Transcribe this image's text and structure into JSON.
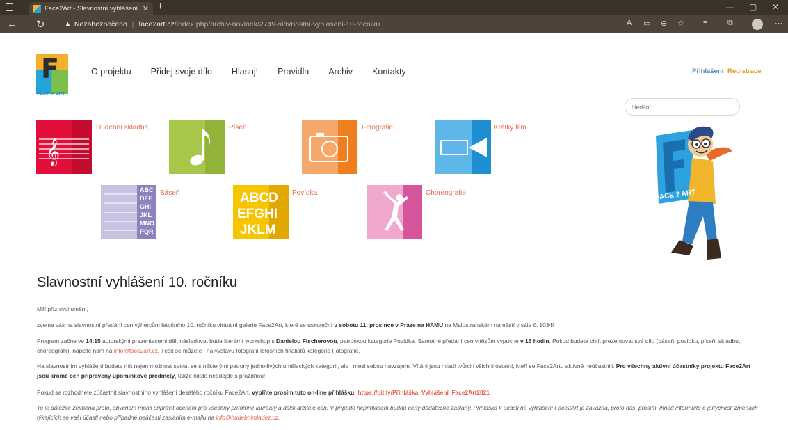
{
  "browser": {
    "tab_title": "Face2Art - Slavnostní vyhlášení 1",
    "security_label": "Nezabezpečeno",
    "url_domain": "face2art.cz",
    "url_path": "/index.php/archiv-novinek/2749-slavnostni-vyhlaseni-10-rocniku"
  },
  "logo": {
    "text": "FACE 2 ART"
  },
  "nav": [
    "O projektu",
    "Přidej svoje dílo",
    "Hlasuj!",
    "Pravidla",
    "Archiv",
    "Kontakty"
  ],
  "auth": {
    "login": "Přihlášení",
    "register": "Registrace"
  },
  "search": {
    "placeholder": "hledání"
  },
  "categories": [
    {
      "label": "Hudební skladba",
      "color": "#e20f3a"
    },
    {
      "label": "Píseň",
      "color": "#a7c74a"
    },
    {
      "label": "Fotografie",
      "color": "#f0812b"
    },
    {
      "label": "Krátký film",
      "color": "#1e8fd3"
    },
    {
      "label": "Báseň",
      "color": "#9c93c6"
    },
    {
      "label": "Povídka",
      "color": "#f5c200"
    },
    {
      "label": "Choreografie",
      "color": "#d6569d"
    }
  ],
  "tiles": {
    "basen": [
      "ABC",
      "DEF",
      "GHI",
      "JKL",
      "MNO",
      "PQR"
    ],
    "povidka": [
      "ABCD",
      "EFGHI",
      "JKLM"
    ]
  },
  "mascot": {
    "text": "FACE 2 ART"
  },
  "article": {
    "title": "Slavnostní vyhlášení 10. ročníku",
    "greeting": "Milí příznivci umění,",
    "p1_a": "zveme vás na slavnostní předání cen výhercům letošního 10. ročníku virtuální galerie Face2Art, které se uskuteční ",
    "p1_b": "v sobotu 11. prosince v Praze na HAMU",
    "p1_c": " na Malostranském náměstí v sále č. 1034!",
    "p2_a": "Program začne ve ",
    "p2_b": "14:15",
    "p2_c": " autorskými prezentacemi děl, následovat bude literární workshop s ",
    "p2_d": "Danielou Fischerovou",
    "p2_e": ", patronkou kategorie Povídka. Samotné předání cen vítězům vypukne ",
    "p2_f": "v 16 hodin",
    "p2_g": ". Pokud budete chtít prezentovat své dílo (báseň, povídku, píseň, skladbu, choreografii), napište nám na ",
    "p2_mail": "info@face2art.cz",
    "p2_h": ". Těšit se můžete i na výstavu fotografií letošních finalistů kategorie Fotografie.",
    "p3_a": "Na slavnostním vyhlášení budete mít nejen možnost setkat se s některými patrony jednotlivých uměleckých kategorií, ale i mezi sebou navzájem. Vítáni jsou mladí tvůrci i všichni ostatní, kteří se Face2Artu aktivně neúčastnili. ",
    "p3_b": "Pro všechny aktivní účastníky projektu Face2Art jsou kromě cen připraveny upomínkové předměty",
    "p3_c": ", takže nikdo neodejde s prázdnou!",
    "p4_a": "Pokud se rozhodnete zúčastnit slavnostního vyhlášení desátého ročníku Face2Art, ",
    "p4_b": "vyplňte prosím tuto on-line přihlášku:",
    "p4_url": "https://bit.ly/Přihláška_Vyhlášení_Face2Art2021",
    "p5_a": "To je důležité zejména proto, abychom mohli připravit ocenění pro všechny přítomné laureáty a další držitele cen. V případě nepřihlášení budou ceny dodatečně zaslány. Přihláška k účasti na vyhlášení Face2Art je závazná, proto nás, prosím, ihned informujte o jakýchkoli změnách týkajících se vaší účasti nebo případné neúčasti zasláním e-mailu na ",
    "p5_mail": "info@hudebnimladez.cz",
    "p5_b": "."
  }
}
